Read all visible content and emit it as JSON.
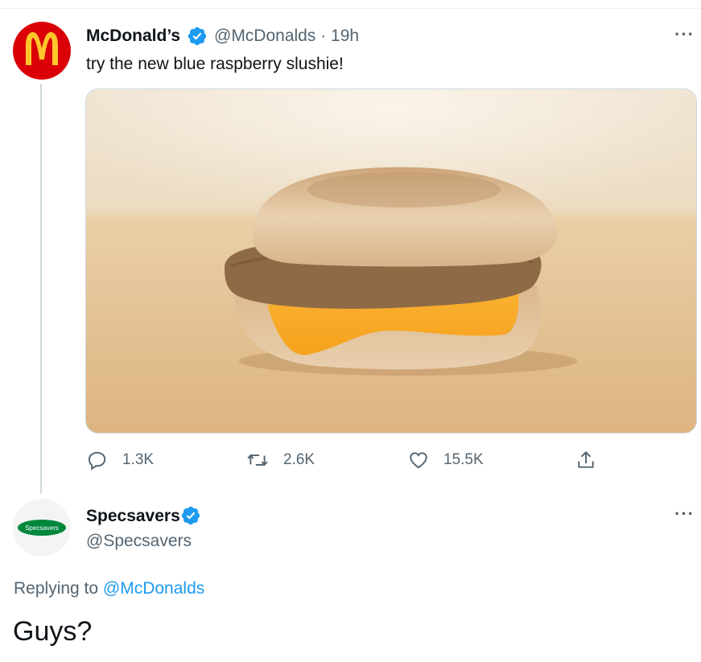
{
  "tweet": {
    "author_name": "McDonald’s",
    "handle_time": "@McDonalds · 19h",
    "text": "try the new blue raspberry slushie!",
    "brand_color": "#db0007",
    "logo_color": "#ffc72c",
    "actions": {
      "reply_count": "1.3K",
      "retweet_count": "2.6K",
      "like_count": "15.5K"
    }
  },
  "reply": {
    "author_name": "Specsavers",
    "handle": "@Specsavers",
    "logo_text": "Specsavers",
    "brand_color": "#00873c",
    "replying_prefix": "Replying to ",
    "replying_handle": "@McDonalds",
    "text": "Guys?"
  },
  "ui": {
    "more_label": "···",
    "verified_color": "#1d9bf0"
  }
}
